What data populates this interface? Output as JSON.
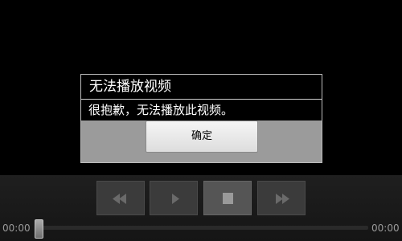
{
  "dialog": {
    "title": "无法播放视频",
    "message": "很抱歉，无法播放此视频。",
    "ok_label": "确定"
  },
  "controls": {
    "buttons": [
      {
        "id": "rewind",
        "icon": "rewind-icon"
      },
      {
        "id": "play",
        "icon": "play-icon"
      },
      {
        "id": "stop",
        "icon": "stop-icon"
      },
      {
        "id": "fast-forward",
        "icon": "fast-forward-icon"
      }
    ],
    "time_elapsed": "00:00",
    "time_total": "00:00",
    "progress": 0
  },
  "colors": {
    "background": "#000000",
    "dialog_button_bar": "#9b9b9b",
    "control_button": "#3b3b3b"
  }
}
